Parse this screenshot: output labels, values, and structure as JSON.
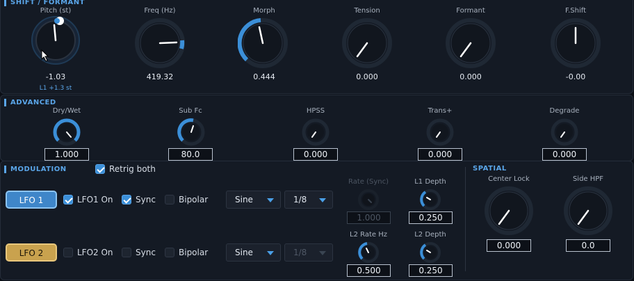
{
  "sections": {
    "shift_formant": "SHIFT / FORMANT",
    "advanced": "ADVANCED",
    "modulation": "MODULATION",
    "spatial": "SPATIAL"
  },
  "shift": {
    "pitch": {
      "label": "Pitch (st)",
      "value": "-1.03",
      "sub": "L1 +1.3 st"
    },
    "freq": {
      "label": "Freq (Hz)",
      "value": "419.32"
    },
    "morph": {
      "label": "Morph",
      "value": "0.444"
    },
    "tension": {
      "label": "Tension",
      "value": "0.000"
    },
    "formant": {
      "label": "Formant",
      "value": "0.000"
    },
    "fshift": {
      "label": "F.Shift",
      "value": "-0.00"
    }
  },
  "advanced": {
    "drywet": {
      "label": "Dry/Wet",
      "value": "1.000"
    },
    "subfc": {
      "label": "Sub Fc",
      "value": "80.0"
    },
    "hpss": {
      "label": "HPSS",
      "value": "0.000"
    },
    "trans": {
      "label": "Trans+",
      "value": "0.000"
    },
    "degrade": {
      "label": "Degrade",
      "value": "0.000"
    }
  },
  "modulation": {
    "retrig_label": "Retrig both",
    "lfo1": {
      "button": "LFO 1",
      "on_label": "LFO1 On",
      "sync_label": "Sync",
      "bipolar_label": "Bipolar",
      "shape": "Sine",
      "rate_div": "1/8"
    },
    "lfo2": {
      "button": "LFO 2",
      "on_label": "LFO2 On",
      "sync_label": "Sync",
      "bipolar_label": "Bipolar",
      "shape": "Sine",
      "rate_div": "1/8"
    },
    "rate_sync": {
      "label": "Rate (Sync)",
      "value": "1.000"
    },
    "l1_depth": {
      "label": "L1 Depth",
      "value": "0.250"
    },
    "l2_rate": {
      "label": "L2 Rate Hz",
      "value": "0.500"
    },
    "l2_depth": {
      "label": "L2 Depth",
      "value": "0.250"
    }
  },
  "spatial": {
    "center_lock": {
      "label": "Center Lock",
      "value": "0.000"
    },
    "side_hpf": {
      "label": "Side HPF",
      "value": "0.0"
    }
  },
  "colors": {
    "accent": "#3b8fd8",
    "lfo1": "#3f86c9",
    "lfo2": "#c9a24e",
    "panel": "#141a24"
  }
}
